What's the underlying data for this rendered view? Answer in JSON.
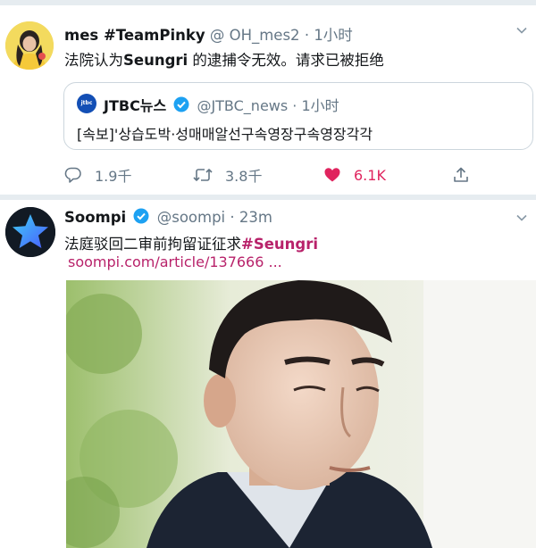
{
  "tweets": [
    {
      "display_name": "mes #TeamPinky",
      "handle": "@ OH_mes2",
      "separator": "·",
      "time": "1小时",
      "text_before": "法院认为",
      "text_bold": "Seungri",
      "text_after": " 的逮捕令无效。请求已被拒绝",
      "quoted": {
        "avatar_text": "jtbc",
        "display_name": "JTBC뉴스",
        "handle": "@JTBC_news",
        "separator": "·",
        "time": "1小时",
        "text": "[속보]'상습도박·성매매알선구속영장구속영장각각"
      },
      "actions": {
        "replies": "1.9千",
        "retweets": "3.8千",
        "likes": "6.1K"
      },
      "icons": [
        "reply-icon",
        "retweet-icon",
        "heart-icon",
        "share-icon",
        "chevron-down-icon",
        "verified-badge-icon"
      ],
      "colors": {
        "like": "#e0245e",
        "verified": "#1da1f2"
      }
    },
    {
      "display_name": "Soompi",
      "handle": "@soompi",
      "separator": "·",
      "time": "23m",
      "text_before": "法庭驳回二审前拘留证征求",
      "hashtag": "#Seungri",
      "link": "soompi.com/article/137666 ...",
      "icons": [
        "star-avatar-icon",
        "verified-badge-icon",
        "chevron-down-icon"
      ],
      "colors": {
        "accent": "#b8226a"
      }
    }
  ]
}
